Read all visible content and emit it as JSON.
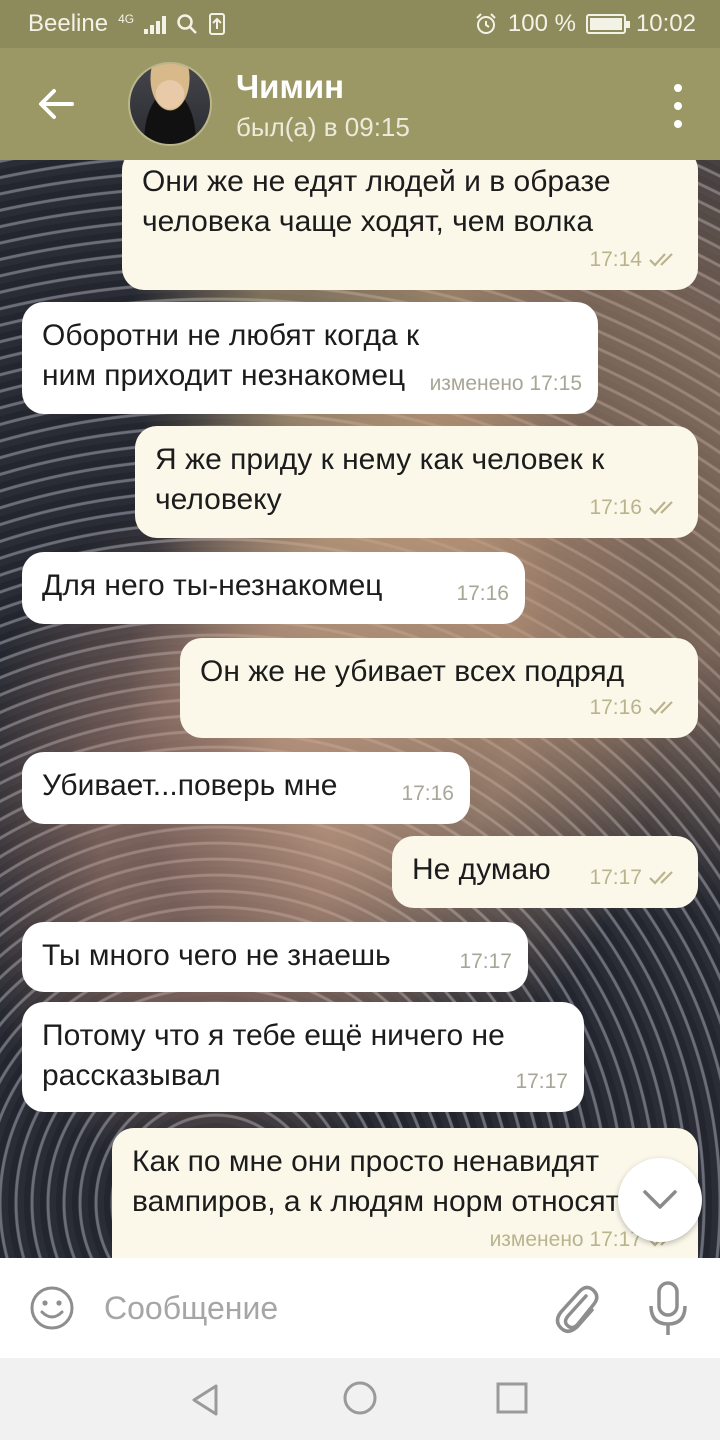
{
  "status_bar": {
    "carrier": "Beeline",
    "network": "4G",
    "battery": "100 %",
    "time": "10:02"
  },
  "header": {
    "contact_name": "Чимин",
    "contact_status": "был(а) в 09:15"
  },
  "messages": [
    {
      "direction": "out",
      "text": "Они же не едят людей и в образе человека чаще ходят, чем волка",
      "time": "17:14",
      "edited": false,
      "read": true
    },
    {
      "direction": "in",
      "text": "Оборотни не любят когда к ним приходит незнакомец",
      "time": "изменено 17:15",
      "edited": true
    },
    {
      "direction": "out",
      "text": "Я же приду к нему как человек к человеку",
      "time": "17:16",
      "read": true
    },
    {
      "direction": "in",
      "text": "Для него ты-незнакомец",
      "time": "17:16"
    },
    {
      "direction": "out",
      "text": "Он же не убивает всех подряд",
      "time": "17:16",
      "read": true
    },
    {
      "direction": "in",
      "text": "Убивает...поверь мне",
      "time": "17:16"
    },
    {
      "direction": "out",
      "text": "Не думаю",
      "time": "17:17",
      "read": true
    },
    {
      "direction": "in",
      "text": "Ты много чего не знаешь",
      "time": "17:17"
    },
    {
      "direction": "in",
      "text": "Потому что я тебе ещё ничего не рассказывал",
      "time": "17:17"
    },
    {
      "direction": "out",
      "text": "Как по мне они просто ненавидят вампиров, а к людям норм относятся",
      "time": "изменено 17:17",
      "read": true
    }
  ],
  "input": {
    "placeholder": "Сообщение"
  },
  "colors": {
    "header": "#9c9866",
    "status_bar": "#8d8a5b",
    "incoming_bubble": "#ffffff",
    "outgoing_bubble": "#fbf8ea",
    "read_ticks": "#b9b48e"
  }
}
